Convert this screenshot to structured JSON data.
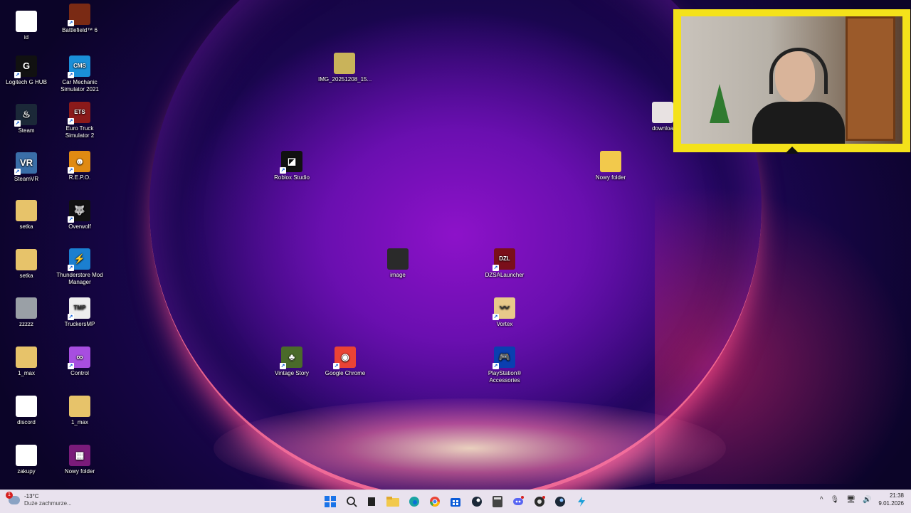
{
  "desktop": {
    "icons": [
      {
        "id": "id",
        "label": "id",
        "glyph": "",
        "bg": "#ffffff"
      },
      {
        "id": "bf6",
        "label": "Battlefield™ 6",
        "glyph": "",
        "bg": "#7a2a14"
      },
      {
        "id": "ghub",
        "label": "Logitech G HUB",
        "glyph": "G",
        "bg": "#111111"
      },
      {
        "id": "cms",
        "label": "Car Mechanic Simulator 2021",
        "glyph": "CMS",
        "bg": "#1a8fd8"
      },
      {
        "id": "steam",
        "label": "Steam",
        "glyph": "♨",
        "bg": "#1b2838"
      },
      {
        "id": "ets2",
        "label": "Euro Truck Simulator 2",
        "glyph": "ETS",
        "bg": "#8b1a1a"
      },
      {
        "id": "steamvr",
        "label": "SteamVR",
        "glyph": "VR",
        "bg": "#3a6ea8"
      },
      {
        "id": "repo",
        "label": "R.E.P.O.",
        "glyph": "☻",
        "bg": "#e08a12"
      },
      {
        "id": "setka1",
        "label": "setka",
        "glyph": "",
        "bg": "#e7c36a"
      },
      {
        "id": "overwolf",
        "label": "Overwolf",
        "glyph": "🐺",
        "bg": "#111111"
      },
      {
        "id": "setka2",
        "label": "setka",
        "glyph": "",
        "bg": "#e7c36a"
      },
      {
        "id": "thunder",
        "label": "Thunderstore Mod Manager",
        "glyph": "⚡",
        "bg": "#1b7fd0"
      },
      {
        "id": "zzzzz",
        "label": "zzzzz",
        "glyph": "",
        "bg": "#9aa0a6"
      },
      {
        "id": "truckersmp",
        "label": "TruckersMP",
        "glyph": "TMP",
        "bg": "#eeeeee"
      },
      {
        "id": "onemax1",
        "label": "1_max",
        "glyph": "",
        "bg": "#e7c36a"
      },
      {
        "id": "control",
        "label": "Control",
        "glyph": "∞",
        "bg": "#a74ee0"
      },
      {
        "id": "discord",
        "label": "discord",
        "glyph": "",
        "bg": "#ffffff"
      },
      {
        "id": "onemax2",
        "label": "1_max",
        "glyph": "",
        "bg": "#e7c36a"
      },
      {
        "id": "zakupy",
        "label": "zakupy",
        "glyph": "",
        "bg": "#ffffff"
      },
      {
        "id": "nowy1",
        "label": "Nowy folder",
        "glyph": "▦",
        "bg": "#7a1b7a"
      },
      {
        "id": "img1",
        "label": "IMG_20251208_15...",
        "glyph": "",
        "bg": "#c9b35a"
      },
      {
        "id": "roblox",
        "label": "Roblox Studio",
        "glyph": "◪",
        "bg": "#111111"
      },
      {
        "id": "nowy2",
        "label": "Nowy folder",
        "glyph": "",
        "bg": "#f2c94c"
      },
      {
        "id": "image",
        "label": "image",
        "glyph": "",
        "bg": "#2a2a2a"
      },
      {
        "id": "dzsa",
        "label": "DZSALauncher",
        "glyph": "DZL",
        "bg": "#7a0f1a"
      },
      {
        "id": "vortex",
        "label": "Vortex",
        "glyph": "〰",
        "bg": "#e8c98a"
      },
      {
        "id": "vintage",
        "label": "Vintage Story",
        "glyph": "♣",
        "bg": "#4a6a2a"
      },
      {
        "id": "chrome",
        "label": "Google Chrome",
        "glyph": "◉",
        "bg": "#ea4335"
      },
      {
        "id": "ps",
        "label": "PlayStation® Accessories",
        "glyph": "🎮",
        "bg": "#0a3fb0"
      },
      {
        "id": "downloa",
        "label": "downloa",
        "glyph": "",
        "bg": "#e8e2e2"
      }
    ]
  },
  "weather": {
    "badge": "1",
    "temp": "-13°C",
    "desc": "Duże zachmurze..."
  },
  "taskbar": {
    "items": [
      "start",
      "search",
      "taskview",
      "explorer",
      "edge",
      "chrome",
      "store",
      "steam",
      "calculator",
      "discord",
      "obs",
      "steam2",
      "thunderstore"
    ]
  },
  "tray": {
    "chevron": "^",
    "time": "21:38",
    "date": "9.01.2026"
  }
}
